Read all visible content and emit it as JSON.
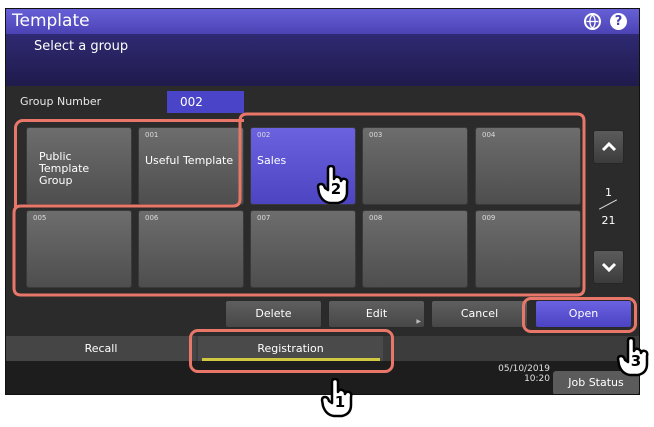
{
  "title": "Template",
  "subtitle": "Select a group",
  "group_number": {
    "label": "Group Number",
    "value": "002"
  },
  "tiles": [
    {
      "num": "",
      "name": "Public\nTemplate\nGroup"
    },
    {
      "num": "001",
      "name": "Useful Template"
    },
    {
      "num": "002",
      "name": "Sales"
    },
    {
      "num": "003",
      "name": ""
    },
    {
      "num": "004",
      "name": ""
    },
    {
      "num": "005",
      "name": ""
    },
    {
      "num": "006",
      "name": ""
    },
    {
      "num": "007",
      "name": ""
    },
    {
      "num": "008",
      "name": ""
    },
    {
      "num": "009",
      "name": ""
    }
  ],
  "pagination": {
    "current": "1",
    "total": "21"
  },
  "actions": {
    "delete": "Delete",
    "edit": "Edit",
    "cancel": "Cancel",
    "open": "Open"
  },
  "tabs": {
    "recall": "Recall",
    "registration": "Registration"
  },
  "datetime": {
    "date": "05/10/2019",
    "time": "10:20"
  },
  "job_status": "Job Status",
  "callout_steps": {
    "step1": "1",
    "step2": "2",
    "step3": "3"
  },
  "icons": {
    "globe": "globe-icon",
    "help": "help-icon",
    "up": "chevron-up-icon",
    "down": "chevron-down-icon",
    "hand": "hand-pointer-icon"
  },
  "colors": {
    "accent": "#4b43b4",
    "selected_tile": "#5a52d6",
    "callout": "#e8776a",
    "underline": "#cfc840"
  }
}
